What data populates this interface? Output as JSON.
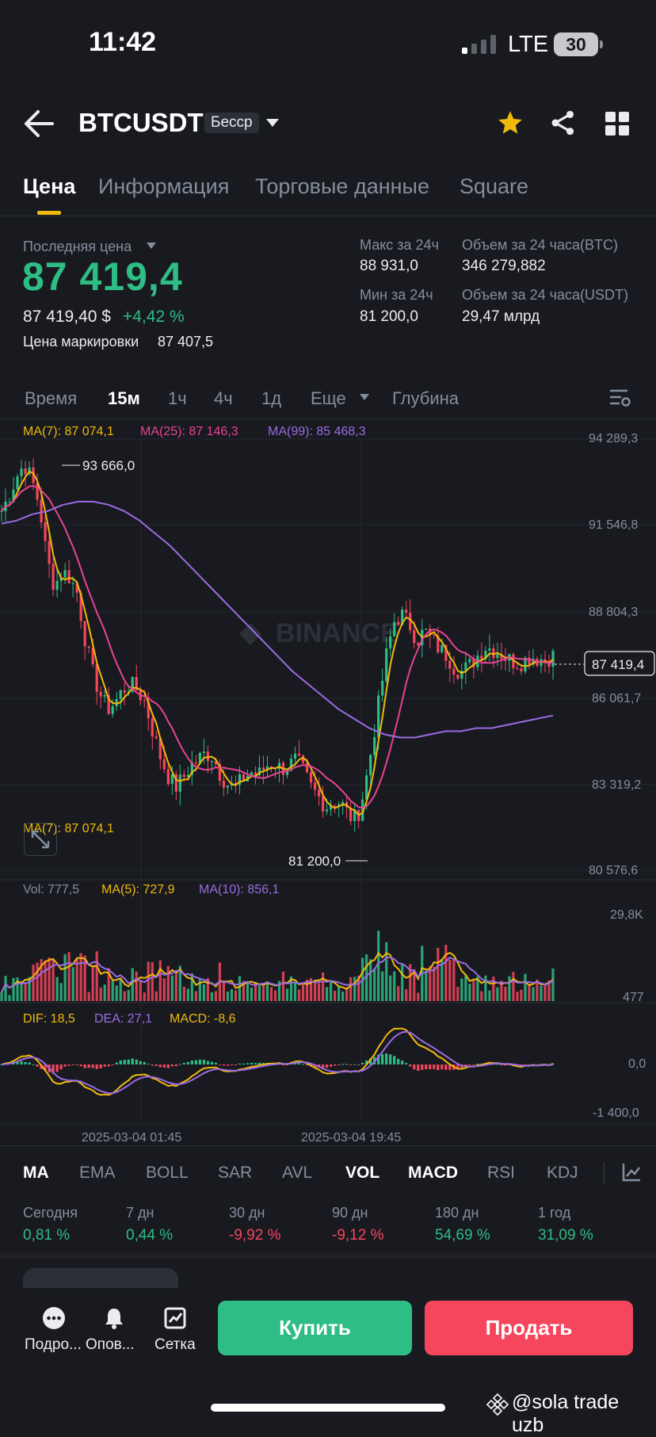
{
  "status": {
    "time": "11:42",
    "network": "LTE",
    "battery": "30"
  },
  "header": {
    "pair": "BTCUSDT",
    "badge": "Бесср"
  },
  "tabs": [
    "Цена",
    "Информация",
    "Торговые данные",
    "Square"
  ],
  "price": {
    "last_label": "Последняя цена",
    "last": "87 419,4",
    "usd": "87 419,40 $",
    "change": "+4,42 %",
    "mark_label": "Цена маркировки",
    "mark": "87 407,5",
    "high_label": "Макс за 24ч",
    "high": "88 931,0",
    "low_label": "Мин за 24ч",
    "low": "81 200,0",
    "vol_btc_label": "Объем за 24 часа(BTC)",
    "vol_btc": "346 279,882",
    "vol_usdt_label": "Объем за 24 часа(USDT)",
    "vol_usdt": "29,47 млрд"
  },
  "intervals": [
    "Время",
    "15м",
    "1ч",
    "4ч",
    "1д",
    "Еще",
    "Глубина"
  ],
  "legend": {
    "ma7": "MA(7): 87 074,1",
    "ma25": "MA(25): 87 146,3",
    "ma99": "MA(99): 85 468,3",
    "vol": "Vol: 777,5",
    "vma5": "MA(5): 727,9",
    "vma10": "MA(10): 856,1",
    "dif": "DIF: 18,5",
    "dea": "DEA: 27,1",
    "macd": "MACD: -8,6"
  },
  "chart_data": {
    "type": "candlestick",
    "price_axis": [
      "94 289,3",
      "91 546,8",
      "88 804,3",
      "86 061,7",
      "83 319,2",
      "80 576,6"
    ],
    "ylim": [
      80576.6,
      94289.3
    ],
    "high_marker": "93 666,0",
    "low_marker": "81 200,0",
    "current_price": "87 419,4",
    "volume_axis": [
      "29,8K",
      "477"
    ],
    "macd_axis": [
      "0,0",
      "-1 400,0"
    ],
    "x_labels": [
      "2025-03-04 01:45",
      "2025-03-04 19:45"
    ],
    "watermark": "BINANCE",
    "colors": {
      "up": "#2ebd85",
      "down": "#f6465d",
      "ma7": "#f0b90b",
      "ma25": "#e84393",
      "ma99": "#9b6be0"
    },
    "close_path": [
      92.0,
      92.5,
      93.1,
      93.5,
      93.0,
      92.2,
      90.5,
      89.6,
      90.1,
      89.9,
      89.4,
      88.0,
      86.9,
      86.2,
      85.7,
      85.9,
      86.3,
      86.5,
      86.3,
      85.9,
      85.0,
      84.2,
      83.6,
      83.2,
      83.5,
      83.9,
      84.1,
      84.3,
      84.2,
      83.6,
      83.3,
      83.2,
      83.5,
      83.7,
      83.6,
      83.9,
      84.0,
      83.8,
      83.9,
      84.1,
      83.7,
      83.2,
      82.9,
      82.6,
      82.8,
      82.7,
      82.3,
      82.2,
      83.1,
      84.5,
      86.0,
      87.5,
      88.5,
      88.7,
      88.4,
      87.9,
      88.2,
      87.9,
      87.6,
      87.4,
      87.0,
      86.9,
      87.1,
      87.4,
      87.7,
      87.6,
      87.5,
      87.3,
      87.2,
      87.2,
      87.4,
      87.3,
      87.3,
      87.4
    ],
    "ma99_path": [
      91.6,
      91.7,
      91.9,
      92.0,
      92.2,
      92.3,
      92.3,
      92.2,
      92.0,
      91.7,
      91.3,
      90.9,
      90.4,
      89.9,
      89.4,
      88.9,
      88.4,
      87.9,
      87.4,
      86.9,
      86.5,
      86.1,
      85.7,
      85.4,
      85.1,
      84.9,
      84.8,
      84.8,
      84.9,
      85.0,
      85.0,
      85.1,
      85.1,
      85.2,
      85.3,
      85.4,
      85.5
    ]
  },
  "indicators": [
    "MA",
    "EMA",
    "BOLL",
    "SAR",
    "AVL",
    "VOL",
    "MACD",
    "RSI",
    "KDJ"
  ],
  "performance": [
    {
      "label": "Сегодня",
      "value": "0,81 %",
      "tone": "up"
    },
    {
      "label": "7 дн",
      "value": "0,44 %",
      "tone": "up"
    },
    {
      "label": "30 дн",
      "value": "-9,92 %",
      "tone": "down"
    },
    {
      "label": "90 дн",
      "value": "-9,12 %",
      "tone": "down"
    },
    {
      "label": "180 дн",
      "value": "54,69 %",
      "tone": "up"
    },
    {
      "label": "1 год",
      "value": "31,09 %",
      "tone": "up"
    }
  ],
  "bottom": {
    "more": "Подро...",
    "alerts": "Опов...",
    "grid": "Сетка",
    "buy": "Купить",
    "sell": "Продать"
  },
  "watermark_text": "@sola trade uzb"
}
